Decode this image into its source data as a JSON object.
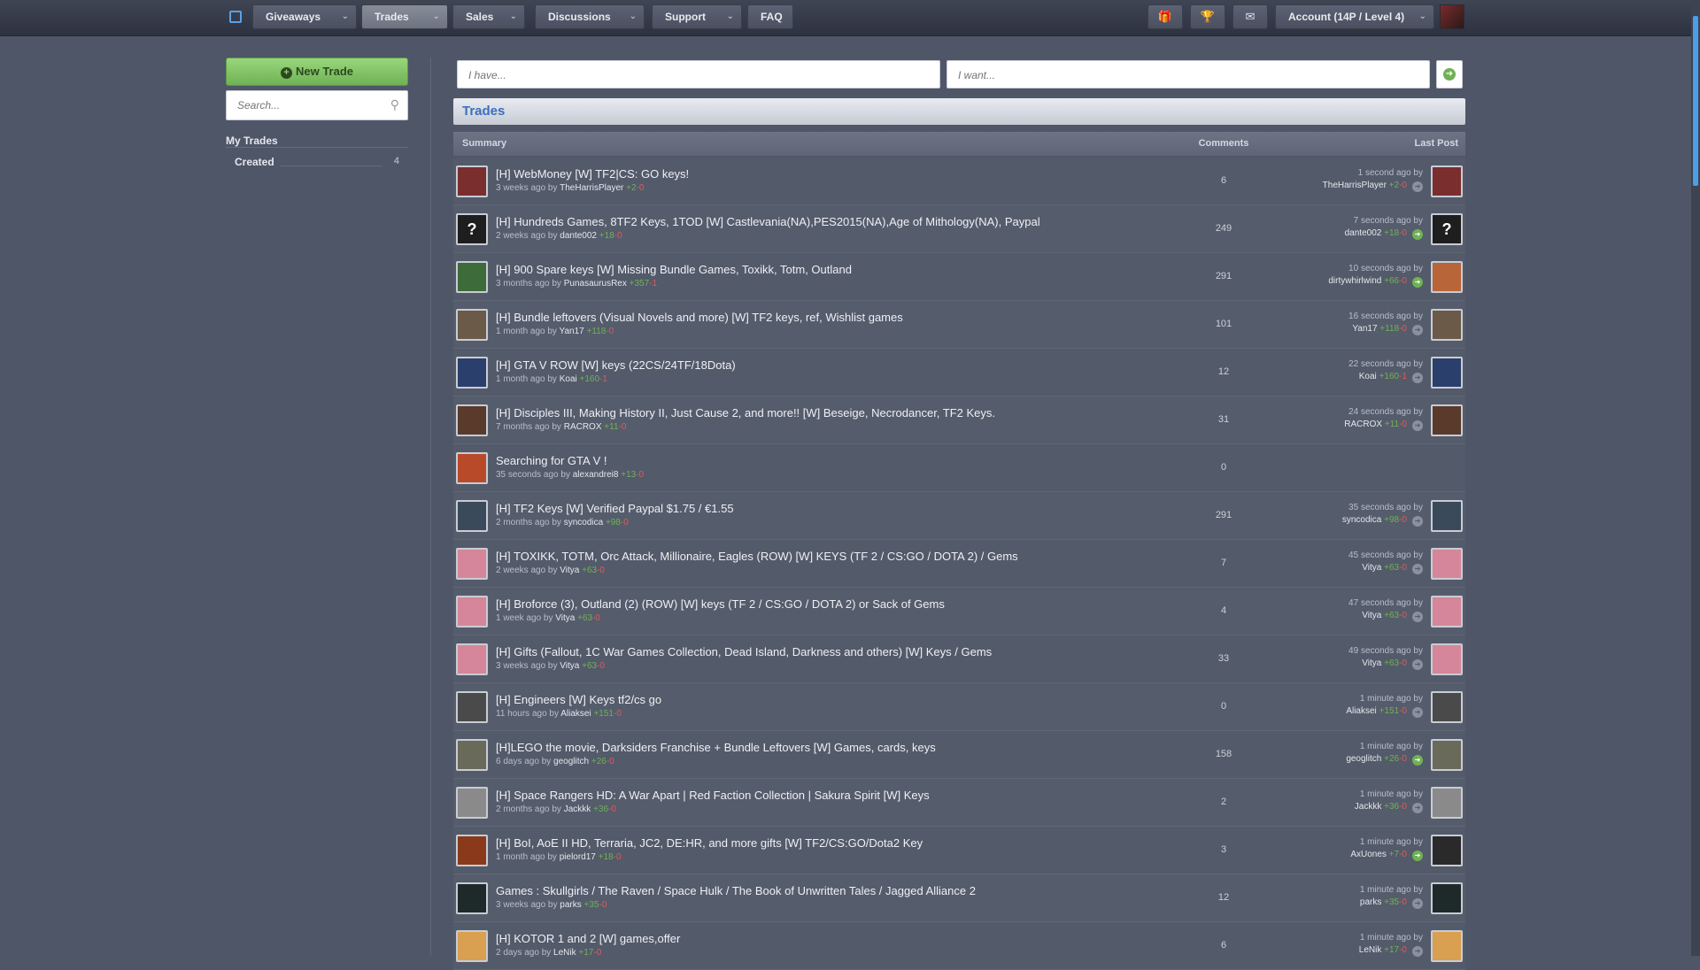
{
  "nav": {
    "items": [
      {
        "label": "Giveaways",
        "chevron": true
      },
      {
        "label": "Trades",
        "chevron": true,
        "active": true
      },
      {
        "label": "Sales",
        "chevron": true
      },
      {
        "label": "Discussions",
        "chevron": true
      },
      {
        "label": "Support",
        "chevron": true
      },
      {
        "label": "FAQ",
        "chevron": false
      }
    ],
    "icons": [
      "gift-icon",
      "trophy-icon",
      "envelope-icon"
    ],
    "account_label": "Account (14P / Level 4)"
  },
  "sidebar": {
    "new_trade_label": "New Trade",
    "search_placeholder": "Search...",
    "my_trades_title": "My Trades",
    "created_label": "Created",
    "created_count": "4"
  },
  "main": {
    "have_placeholder": "I have...",
    "want_placeholder": "I want...",
    "section_title": "Trades",
    "columns": {
      "summary": "Summary",
      "comments": "Comments",
      "last_post": "Last Post"
    }
  },
  "colors": {
    "accent": "#3a6fbf",
    "positive": "#6fb255",
    "negative": "#e05a5a",
    "background": "#4f5667"
  },
  "trades": [
    {
      "title": "[H] WebMoney [W] TF2|CS: GO keys!",
      "age": "3 weeks ago by",
      "author": "TheHarrisPlayer",
      "author_pos": "+2",
      "author_neg": "-0",
      "comments": "6",
      "last_time": "1 second ago by",
      "last_user": "TheHarrisPlayer",
      "last_pos": "+2",
      "last_neg": "-0",
      "new": false,
      "avatar_color": "#7a2e2e",
      "last_avatar_color": "#7a2e2e",
      "avatar_char": "",
      "last_avatar_char": ""
    },
    {
      "title": "[H] Hundreds Games, 8TF2 Keys, 1TOD [W] Castlevania(NA),PES2015(NA),Age of Mithology(NA), Paypal",
      "age": "2 weeks ago by",
      "author": "dante002",
      "author_pos": "+18",
      "author_neg": "-0",
      "comments": "249",
      "last_time": "7 seconds ago by",
      "last_user": "dante002",
      "last_pos": "+18",
      "last_neg": "-0",
      "new": true,
      "avatar_color": "#1e1e1e",
      "last_avatar_color": "#1e1e1e",
      "avatar_char": "?",
      "last_avatar_char": "?"
    },
    {
      "title": "[H] 900 Spare keys [W] Missing Bundle Games, Toxikk, Totm, Outland",
      "age": "3 months ago by",
      "author": "PunasaurusRex",
      "author_pos": "+357",
      "author_neg": "-1",
      "comments": "291",
      "last_time": "10 seconds ago by",
      "last_user": "dirtywhirlwind",
      "last_pos": "+66",
      "last_neg": "-0",
      "new": true,
      "avatar_color": "#3e6b3a",
      "last_avatar_color": "#b8653a",
      "avatar_char": "",
      "last_avatar_char": ""
    },
    {
      "title": "[H] Bundle leftovers (Visual Novels and more) [W] TF2 keys, ref, Wishlist games",
      "age": "1 month ago by",
      "author": "Yan17",
      "author_pos": "+118",
      "author_neg": "-0",
      "comments": "101",
      "last_time": "16 seconds ago by",
      "last_user": "Yan17",
      "last_pos": "+118",
      "last_neg": "-0",
      "new": false,
      "avatar_color": "#6b5a48",
      "last_avatar_color": "#6b5a48",
      "avatar_char": "",
      "last_avatar_char": ""
    },
    {
      "title": "[H] GTA V ROW [W] keys (22CS/24TF/18Dota)",
      "age": "1 month ago by",
      "author": "Koai",
      "author_pos": "+160",
      "author_neg": "-1",
      "comments": "12",
      "last_time": "22 seconds ago by",
      "last_user": "Koai",
      "last_pos": "+160",
      "last_neg": "-1",
      "new": false,
      "avatar_color": "#2a3f6b",
      "last_avatar_color": "#2a3f6b",
      "avatar_char": "",
      "last_avatar_char": ""
    },
    {
      "title": "[H] Disciples III, Making History II, Just Cause 2, and more!! [W] Beseige, Necrodancer, TF2 Keys.",
      "age": "7 months ago by",
      "author": "RACROX",
      "author_pos": "+11",
      "author_neg": "-0",
      "comments": "31",
      "last_time": "24 seconds ago by",
      "last_user": "RACROX",
      "last_pos": "+11",
      "last_neg": "-0",
      "new": false,
      "avatar_color": "#5a3a2a",
      "last_avatar_color": "#5a3a2a",
      "avatar_char": "",
      "last_avatar_char": ""
    },
    {
      "title": "Searching for GTA V !",
      "age": "35 seconds ago by",
      "author": "alexandrei8",
      "author_pos": "+13",
      "author_neg": "-0",
      "comments": "0",
      "last_time": "",
      "last_user": "",
      "last_pos": "",
      "last_neg": "",
      "new": false,
      "avatar_color": "#b84a2a",
      "last_avatar_color": "",
      "avatar_char": "",
      "last_avatar_char": ""
    },
    {
      "title": "[H] TF2 Keys [W] Verified Paypal $1.75 / €1.55",
      "age": "2 months ago by",
      "author": "syncodica",
      "author_pos": "+98",
      "author_neg": "-0",
      "comments": "291",
      "last_time": "35 seconds ago by",
      "last_user": "syncodica",
      "last_pos": "+98",
      "last_neg": "-0",
      "new": false,
      "avatar_color": "#3a4a5a",
      "last_avatar_color": "#3a4a5a",
      "avatar_char": "",
      "last_avatar_char": ""
    },
    {
      "title": "[H] TOXIKK, TOTM, Orc Attack, Millionaire, Eagles (ROW) [W] KEYS (TF 2 / CS:GO / DOTA 2) / Gems",
      "age": "2 weeks ago by",
      "author": "Vitya",
      "author_pos": "+63",
      "author_neg": "-0",
      "comments": "7",
      "last_time": "45 seconds ago by",
      "last_user": "Vitya",
      "last_pos": "+63",
      "last_neg": "-0",
      "new": false,
      "avatar_color": "#d6869a",
      "last_avatar_color": "#d6869a",
      "avatar_char": "",
      "last_avatar_char": ""
    },
    {
      "title": "[H] Broforce (3), Outland (2) (ROW) [W] keys (TF 2 / CS:GO / DOTA 2) or Sack of Gems",
      "age": "1 week ago by",
      "author": "Vitya",
      "author_pos": "+63",
      "author_neg": "-0",
      "comments": "4",
      "last_time": "47 seconds ago by",
      "last_user": "Vitya",
      "last_pos": "+63",
      "last_neg": "-0",
      "new": false,
      "avatar_color": "#d6869a",
      "last_avatar_color": "#d6869a",
      "avatar_char": "",
      "last_avatar_char": ""
    },
    {
      "title": "[H] Gifts (Fallout, 1C War Games Collection, Dead Island, Darkness and others) [W] Keys / Gems",
      "age": "3 weeks ago by",
      "author": "Vitya",
      "author_pos": "+63",
      "author_neg": "-0",
      "comments": "33",
      "last_time": "49 seconds ago by",
      "last_user": "Vitya",
      "last_pos": "+63",
      "last_neg": "-0",
      "new": false,
      "avatar_color": "#d6869a",
      "last_avatar_color": "#d6869a",
      "avatar_char": "",
      "last_avatar_char": ""
    },
    {
      "title": "[H] Engineers [W] Keys tf2/cs go",
      "age": "11 hours ago by",
      "author": "Aliaksei",
      "author_pos": "+151",
      "author_neg": "-0",
      "comments": "0",
      "last_time": "1 minute ago by",
      "last_user": "Aliaksei",
      "last_pos": "+151",
      "last_neg": "-0",
      "new": false,
      "avatar_color": "#4a4a4a",
      "last_avatar_color": "#4a4a4a",
      "avatar_char": "",
      "last_avatar_char": ""
    },
    {
      "title": "[H]LEGO the movie, Darksiders Franchise + Bundle Leftovers [W] Games, cards, keys",
      "age": "6 days ago by",
      "author": "geoglitch",
      "author_pos": "+26",
      "author_neg": "-0",
      "comments": "158",
      "last_time": "1 minute ago by",
      "last_user": "geoglitch",
      "last_pos": "+26",
      "last_neg": "-0",
      "new": true,
      "avatar_color": "#6a6a5a",
      "last_avatar_color": "#6a6a5a",
      "avatar_char": "",
      "last_avatar_char": ""
    },
    {
      "title": "[H] Space Rangers HD: A War Apart | Red Faction Collection | Sakura Spirit [W] Keys",
      "age": "2 months ago by",
      "author": "Jackkk",
      "author_pos": "+36",
      "author_neg": "-0",
      "comments": "2",
      "last_time": "1 minute ago by",
      "last_user": "Jackkk",
      "last_pos": "+36",
      "last_neg": "-0",
      "new": false,
      "avatar_color": "#8a8a8a",
      "last_avatar_color": "#8a8a8a",
      "avatar_char": "",
      "last_avatar_char": ""
    },
    {
      "title": "[H] BoI, AoE II HD, Terraria, JC2, DE:HR, and more gifts [W] TF2/CS:GO/Dota2 Key",
      "age": "1 month ago by",
      "author": "pielord17",
      "author_pos": "+18",
      "author_neg": "-0",
      "comments": "3",
      "last_time": "1 minute ago by",
      "last_user": "AxUones",
      "last_pos": "+7",
      "last_neg": "-0",
      "new": true,
      "avatar_color": "#8a3a1a",
      "last_avatar_color": "#2a2a2a",
      "avatar_char": "",
      "last_avatar_char": ""
    },
    {
      "title": "Games : Skullgirls / The Raven / Space Hulk / The Book of Unwritten Tales / Jagged Alliance 2",
      "age": "3 weeks ago by",
      "author": "parks",
      "author_pos": "+35",
      "author_neg": "-0",
      "comments": "12",
      "last_time": "1 minute ago by",
      "last_user": "parks",
      "last_pos": "+35",
      "last_neg": "-0",
      "new": false,
      "avatar_color": "#1e2a2a",
      "last_avatar_color": "#1e2a2a",
      "avatar_char": "",
      "last_avatar_char": ""
    },
    {
      "title": "[H] KOTOR 1 and 2 [W] games,offer",
      "age": "2 days ago by",
      "author": "LeNik",
      "author_pos": "+17",
      "author_neg": "-0",
      "comments": "6",
      "last_time": "1 minute ago by",
      "last_user": "LeNik",
      "last_pos": "+17",
      "last_neg": "-0",
      "new": false,
      "avatar_color": "#d8a050",
      "last_avatar_color": "#d8a050",
      "avatar_char": "",
      "last_avatar_char": ""
    }
  ]
}
